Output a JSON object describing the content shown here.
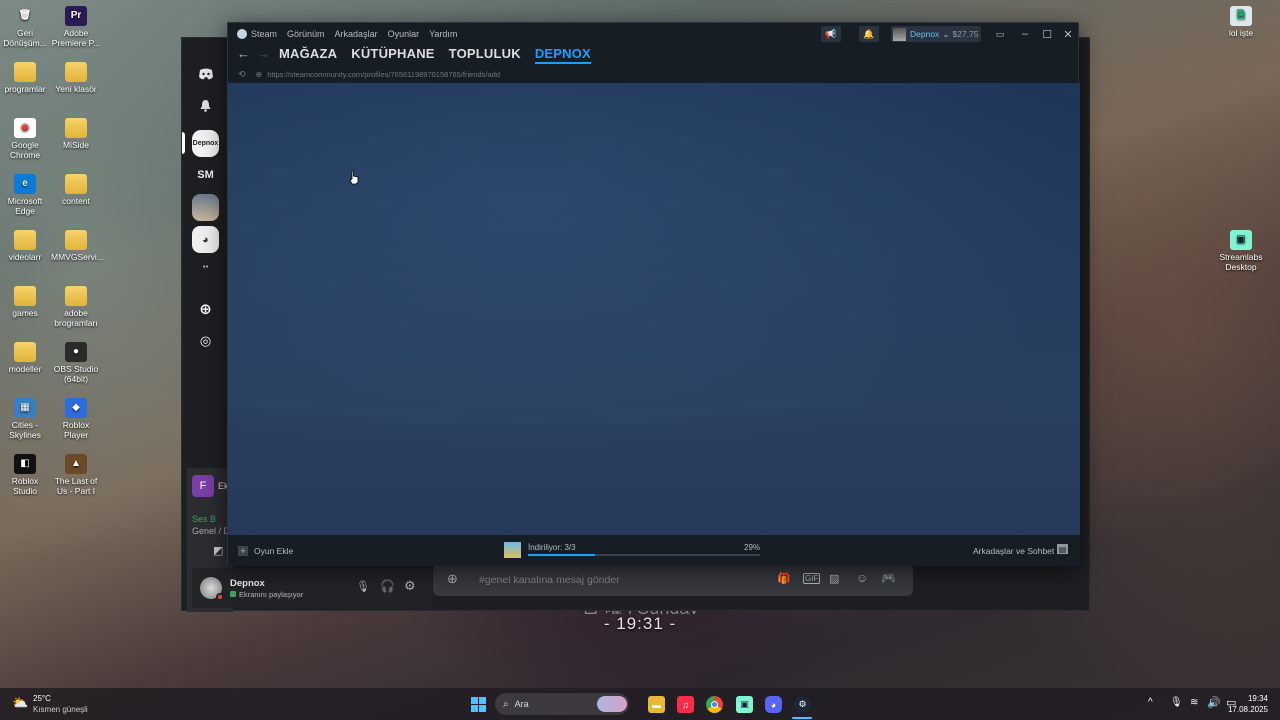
{
  "desktop": {
    "icons_left": [
      {
        "label": "Geri Dönüşüm...",
        "icon": "recycle-bin-icon",
        "glyph": "🗑"
      },
      {
        "label": "Adobe Premiere P...",
        "icon": "premiere-icon",
        "glyph": "Pr"
      },
      {
        "label": "programlar",
        "icon": "folder-icon",
        "glyph": ""
      },
      {
        "label": "Yeni klasör",
        "icon": "folder-icon",
        "glyph": ""
      },
      {
        "label": "Google Chrome",
        "icon": "chrome-icon",
        "glyph": "◉"
      },
      {
        "label": "MiSide",
        "icon": "folder-icon",
        "glyph": ""
      },
      {
        "label": "Microsoft Edge",
        "icon": "edge-icon",
        "glyph": "e"
      },
      {
        "label": "content",
        "icon": "folder-icon",
        "glyph": ""
      },
      {
        "label": "videolarr",
        "icon": "folder-icon",
        "glyph": ""
      },
      {
        "label": "MMVGServi...",
        "icon": "folder-icon",
        "glyph": ""
      },
      {
        "label": "games",
        "icon": "folder-icon",
        "glyph": ""
      },
      {
        "label": "adobe brogramları",
        "icon": "folder-icon",
        "glyph": ""
      },
      {
        "label": "modeller",
        "icon": "folder-icon",
        "glyph": ""
      },
      {
        "label": "OBS Studio (64bit)",
        "icon": "obs-icon",
        "glyph": "●"
      },
      {
        "label": "Cities - Skylines",
        "icon": "cities-skylines-icon",
        "glyph": "▦"
      },
      {
        "label": "Roblox Player",
        "icon": "roblox-icon",
        "glyph": "◆"
      },
      {
        "label": "Roblox Studio",
        "icon": "roblox-studio-icon",
        "glyph": "◧"
      },
      {
        "label": "The Last of Us - Part I",
        "icon": "tlou-icon",
        "glyph": "▲"
      }
    ],
    "icons_right": [
      {
        "label": "lol işte",
        "icon": "file-icon"
      },
      {
        "label": "Streamlabs Desktop",
        "icon": "streamlabs-icon"
      }
    ],
    "clock_widget": {
      "date": "日 曜 | Sunday",
      "time": "- 19:31 -"
    }
  },
  "discord": {
    "servers": [
      "discord-home-icon",
      "notification-bell-icon",
      "Depnox",
      "SM",
      "avatar-server",
      "avatar-server-2",
      "server-group"
    ],
    "server_labels": {
      "depnox": "Depnox",
      "sm": "SM"
    },
    "channel_partial": {
      "initial": "F",
      "name": "Ekr",
      "voice": "Ses B",
      "sub": "Genel / D"
    },
    "user": {
      "name": "Depnox",
      "status": "Ekranını paylaşıyor"
    },
    "message_placeholder": "#genel kanalına mesaj gönder"
  },
  "steam": {
    "menu": [
      "Steam",
      "Görünüm",
      "Arkadaşlar",
      "Oyunlar",
      "Yardım"
    ],
    "account": {
      "name": "Depnox",
      "balance": "$27.75"
    },
    "nav": [
      "MAĞAZA",
      "KÜTÜPHANE",
      "TOPLULUK",
      "DEPNOX"
    ],
    "active_nav": "DEPNOX",
    "url": "https://steamcommunity.com/profiles/76561198970158765/friends/add",
    "footer": {
      "add_game": "Oyun Ekle",
      "download_status": "İndiriliyor: 3/3",
      "download_percent": "29%",
      "download_progress": 0.29,
      "friends_chat": "Arkadaşlar ve Sohbet"
    }
  },
  "taskbar": {
    "weather": {
      "temp": "25°C",
      "desc": "Kısmen güneşli"
    },
    "search_placeholder": "Ara",
    "apps": [
      "windows-start-icon",
      "search-icon",
      "widgets-icon",
      "file-explorer-icon",
      "itunes-icon",
      "chrome-icon",
      "streamlabs-icon",
      "discord-icon",
      "steam-icon"
    ],
    "clock": {
      "time": "19:34",
      "date": "17.08.2025"
    }
  },
  "colors": {
    "steam_accent": "#1a9fff",
    "steam_active_nav": "#66c0f4",
    "discord_bg": "#1e1f22"
  }
}
